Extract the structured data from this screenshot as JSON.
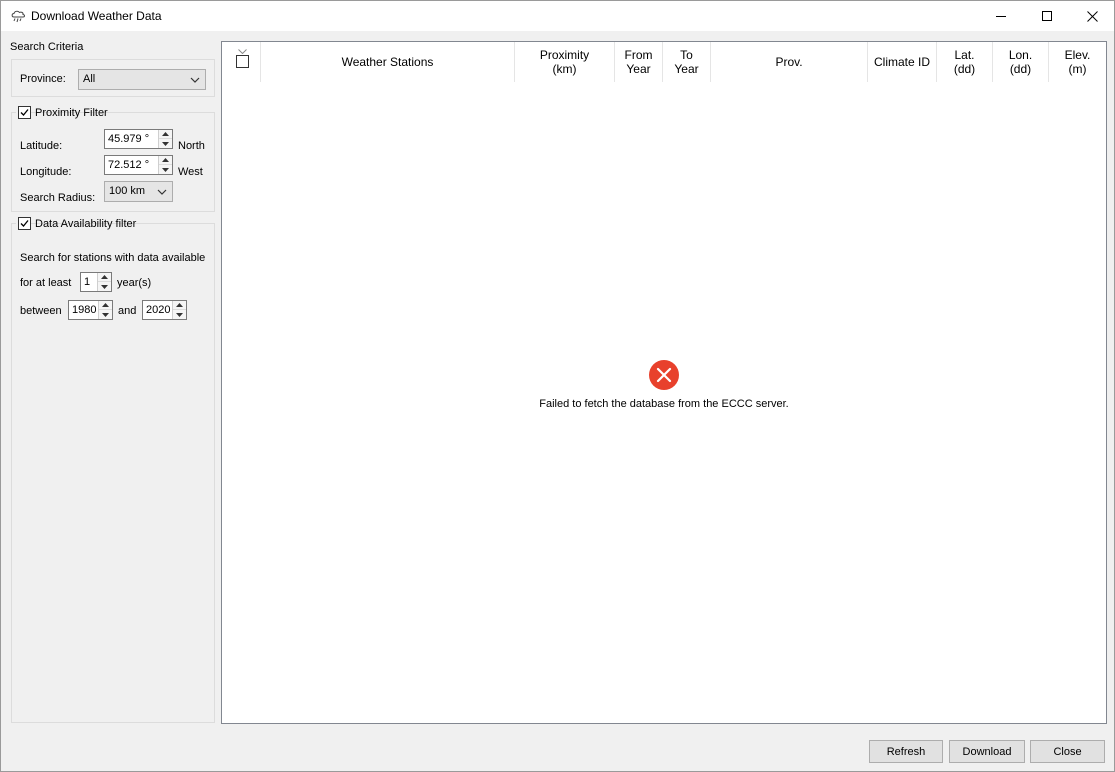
{
  "window": {
    "title": "Download Weather Data",
    "icon": "cloud-rain-icon"
  },
  "search": {
    "section_title": "Search Criteria",
    "province_label": "Province:",
    "province_value": "All",
    "proximity_filter_label": "Proximity Filter",
    "proximity_filter_checked": true,
    "latitude_label": "Latitude:",
    "latitude_value": "45.979 °",
    "latitude_hemisphere": "North",
    "longitude_label": "Longitude:",
    "longitude_value": "72.512 °",
    "longitude_hemisphere": "West",
    "radius_label": "Search Radius:",
    "radius_value": "100 km",
    "availability_filter_label": "Data Availability filter",
    "availability_filter_checked": true,
    "availability_text": "Search for stations with data available",
    "for_at_least_label": "for at least",
    "min_years_value": "1",
    "years_label": "year(s)",
    "between_label": "between",
    "start_year_value": "1980",
    "and_label": "and",
    "end_year_value": "2020"
  },
  "table": {
    "columns": [
      "Weather Stations",
      "Proximity\n(km)",
      "From\nYear",
      "To\nYear",
      "Prov.",
      "Climate ID",
      "Lat.\n(dd)",
      "Lon.\n(dd)",
      "Elev.\n(m)"
    ],
    "error_message": "Failed to fetch the database from the ECCC server.",
    "error_icon": "error-x-icon"
  },
  "buttons": {
    "refresh": "Refresh",
    "download": "Download",
    "close": "Close"
  },
  "colors": {
    "error_red": "#e8412c",
    "window_bg": "#f0f0f0"
  }
}
